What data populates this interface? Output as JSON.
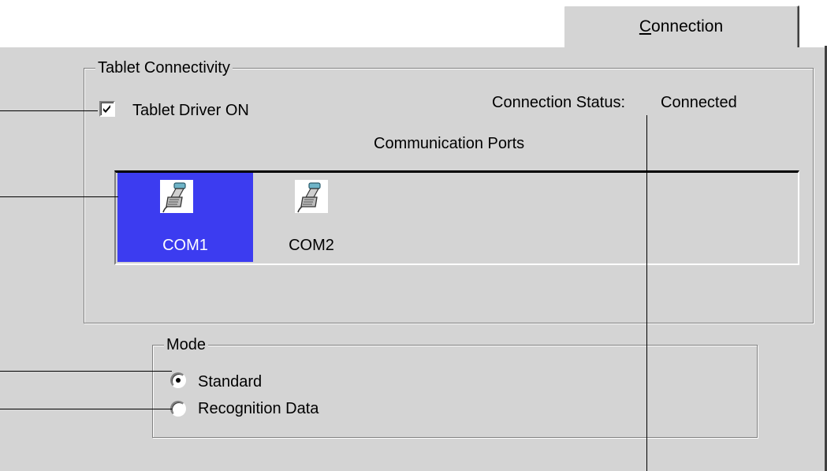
{
  "tabs": [
    {
      "label_accel": "C",
      "label_rest": "onnection",
      "selected": true
    }
  ],
  "tablet_connectivity": {
    "title": "Tablet Connectivity",
    "driver_checkbox": {
      "label": "Tablet Driver ON",
      "checked": true
    },
    "status_label": "Connection Status:",
    "status_value": "Connected",
    "ports_title": "Communication Ports",
    "ports": [
      {
        "label": "COM1",
        "icon": "serial-cable-icon",
        "selected": true
      },
      {
        "label": "COM2",
        "icon": "serial-cable-icon",
        "selected": false
      }
    ]
  },
  "mode": {
    "title": "Mode",
    "options": [
      {
        "label": "Standard",
        "selected": true
      },
      {
        "label": "Recognition Data",
        "selected": false
      }
    ]
  },
  "colors": {
    "panel": "#d4d4d4",
    "selection": "#3c3cf0",
    "connector_blue": "#6fb4c8"
  }
}
